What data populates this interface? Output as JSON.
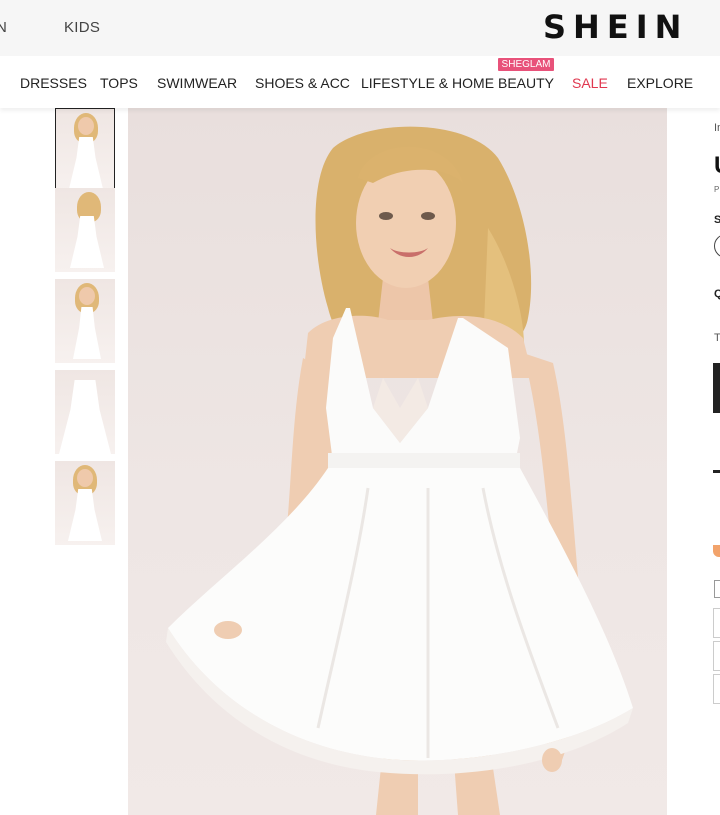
{
  "top_nav": {
    "cut_link": "N",
    "kids": "KIDS",
    "logo": "SHEIN"
  },
  "categories": [
    {
      "label": "DRESSES"
    },
    {
      "label": "TOPS"
    },
    {
      "label": "SWIMWEAR"
    },
    {
      "label": "SHOES & ACC"
    },
    {
      "label": "LIFESTYLE & HOME"
    },
    {
      "label": "BEAUTY"
    },
    {
      "label": "SALE"
    },
    {
      "label": "EXPLORE"
    }
  ],
  "beauty_badge": "SHEGLAM",
  "colors": {
    "sale": "#e0374f",
    "badge": "#e8527a",
    "topbar": "#f6f6f6",
    "photo_bg": "#ede4e2"
  },
  "product_images": {
    "thumbnail_count": 5,
    "active_index": 0
  },
  "info_panel": {
    "line1": "In",
    "title": "U",
    "small": "P",
    "size_label": "S",
    "qty_label": "Q",
    "t_label": "T"
  }
}
